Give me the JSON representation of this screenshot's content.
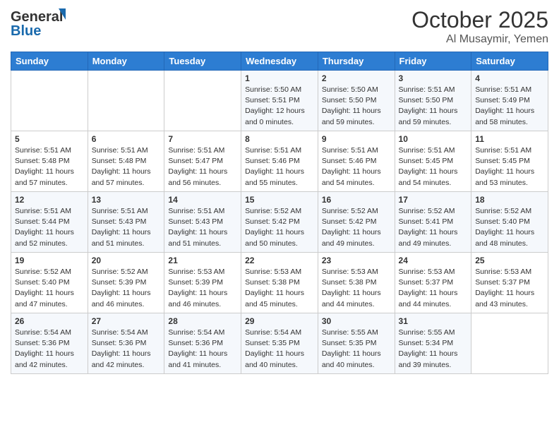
{
  "header": {
    "logo_text_general": "General",
    "logo_text_blue": "Blue",
    "month_title": "October 2025",
    "location": "Al Musaymir, Yemen"
  },
  "days_of_week": [
    "Sunday",
    "Monday",
    "Tuesday",
    "Wednesday",
    "Thursday",
    "Friday",
    "Saturday"
  ],
  "weeks": [
    [
      {
        "day": "",
        "info": ""
      },
      {
        "day": "",
        "info": ""
      },
      {
        "day": "",
        "info": ""
      },
      {
        "day": "1",
        "info": "Sunrise: 5:50 AM\nSunset: 5:51 PM\nDaylight: 12 hours and 0 minutes."
      },
      {
        "day": "2",
        "info": "Sunrise: 5:50 AM\nSunset: 5:50 PM\nDaylight: 11 hours and 59 minutes."
      },
      {
        "day": "3",
        "info": "Sunrise: 5:51 AM\nSunset: 5:50 PM\nDaylight: 11 hours and 59 minutes."
      },
      {
        "day": "4",
        "info": "Sunrise: 5:51 AM\nSunset: 5:49 PM\nDaylight: 11 hours and 58 minutes."
      }
    ],
    [
      {
        "day": "5",
        "info": "Sunrise: 5:51 AM\nSunset: 5:48 PM\nDaylight: 11 hours and 57 minutes."
      },
      {
        "day": "6",
        "info": "Sunrise: 5:51 AM\nSunset: 5:48 PM\nDaylight: 11 hours and 57 minutes."
      },
      {
        "day": "7",
        "info": "Sunrise: 5:51 AM\nSunset: 5:47 PM\nDaylight: 11 hours and 56 minutes."
      },
      {
        "day": "8",
        "info": "Sunrise: 5:51 AM\nSunset: 5:46 PM\nDaylight: 11 hours and 55 minutes."
      },
      {
        "day": "9",
        "info": "Sunrise: 5:51 AM\nSunset: 5:46 PM\nDaylight: 11 hours and 54 minutes."
      },
      {
        "day": "10",
        "info": "Sunrise: 5:51 AM\nSunset: 5:45 PM\nDaylight: 11 hours and 54 minutes."
      },
      {
        "day": "11",
        "info": "Sunrise: 5:51 AM\nSunset: 5:45 PM\nDaylight: 11 hours and 53 minutes."
      }
    ],
    [
      {
        "day": "12",
        "info": "Sunrise: 5:51 AM\nSunset: 5:44 PM\nDaylight: 11 hours and 52 minutes."
      },
      {
        "day": "13",
        "info": "Sunrise: 5:51 AM\nSunset: 5:43 PM\nDaylight: 11 hours and 51 minutes."
      },
      {
        "day": "14",
        "info": "Sunrise: 5:51 AM\nSunset: 5:43 PM\nDaylight: 11 hours and 51 minutes."
      },
      {
        "day": "15",
        "info": "Sunrise: 5:52 AM\nSunset: 5:42 PM\nDaylight: 11 hours and 50 minutes."
      },
      {
        "day": "16",
        "info": "Sunrise: 5:52 AM\nSunset: 5:42 PM\nDaylight: 11 hours and 49 minutes."
      },
      {
        "day": "17",
        "info": "Sunrise: 5:52 AM\nSunset: 5:41 PM\nDaylight: 11 hours and 49 minutes."
      },
      {
        "day": "18",
        "info": "Sunrise: 5:52 AM\nSunset: 5:40 PM\nDaylight: 11 hours and 48 minutes."
      }
    ],
    [
      {
        "day": "19",
        "info": "Sunrise: 5:52 AM\nSunset: 5:40 PM\nDaylight: 11 hours and 47 minutes."
      },
      {
        "day": "20",
        "info": "Sunrise: 5:52 AM\nSunset: 5:39 PM\nDaylight: 11 hours and 46 minutes."
      },
      {
        "day": "21",
        "info": "Sunrise: 5:53 AM\nSunset: 5:39 PM\nDaylight: 11 hours and 46 minutes."
      },
      {
        "day": "22",
        "info": "Sunrise: 5:53 AM\nSunset: 5:38 PM\nDaylight: 11 hours and 45 minutes."
      },
      {
        "day": "23",
        "info": "Sunrise: 5:53 AM\nSunset: 5:38 PM\nDaylight: 11 hours and 44 minutes."
      },
      {
        "day": "24",
        "info": "Sunrise: 5:53 AM\nSunset: 5:37 PM\nDaylight: 11 hours and 44 minutes."
      },
      {
        "day": "25",
        "info": "Sunrise: 5:53 AM\nSunset: 5:37 PM\nDaylight: 11 hours and 43 minutes."
      }
    ],
    [
      {
        "day": "26",
        "info": "Sunrise: 5:54 AM\nSunset: 5:36 PM\nDaylight: 11 hours and 42 minutes."
      },
      {
        "day": "27",
        "info": "Sunrise: 5:54 AM\nSunset: 5:36 PM\nDaylight: 11 hours and 42 minutes."
      },
      {
        "day": "28",
        "info": "Sunrise: 5:54 AM\nSunset: 5:36 PM\nDaylight: 11 hours and 41 minutes."
      },
      {
        "day": "29",
        "info": "Sunrise: 5:54 AM\nSunset: 5:35 PM\nDaylight: 11 hours and 40 minutes."
      },
      {
        "day": "30",
        "info": "Sunrise: 5:55 AM\nSunset: 5:35 PM\nDaylight: 11 hours and 40 minutes."
      },
      {
        "day": "31",
        "info": "Sunrise: 5:55 AM\nSunset: 5:34 PM\nDaylight: 11 hours and 39 minutes."
      },
      {
        "day": "",
        "info": ""
      }
    ]
  ]
}
